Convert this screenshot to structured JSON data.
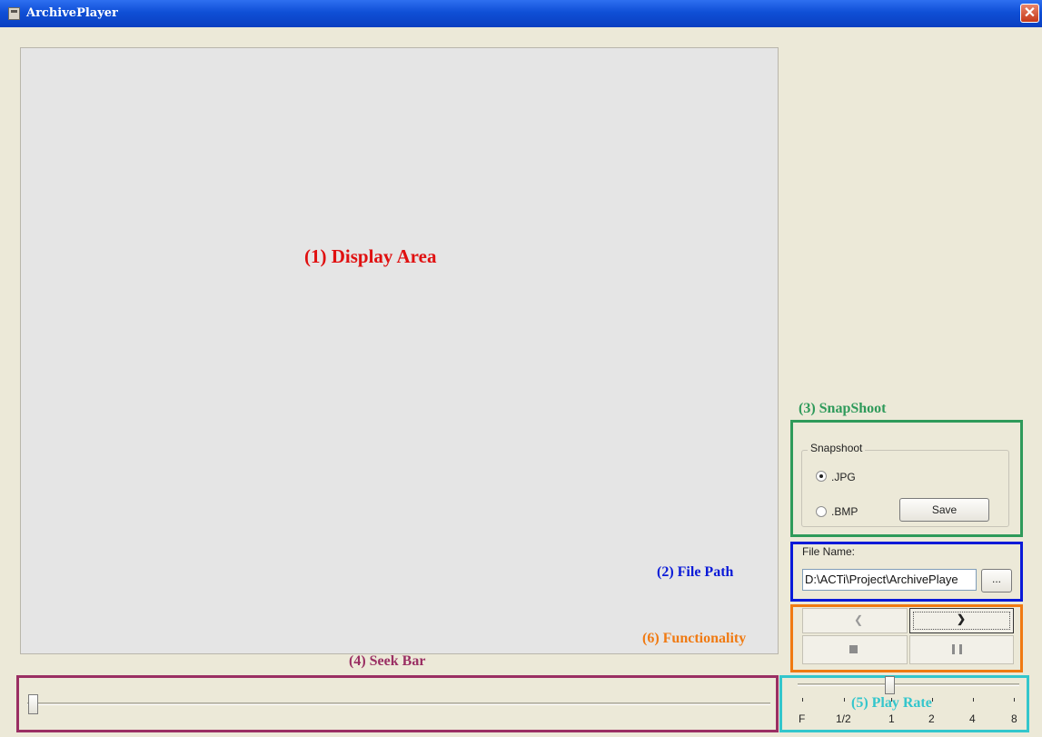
{
  "window": {
    "title": "ArchivePlayer",
    "close_glyph": "✕",
    "icon": "app-icon"
  },
  "annotations": {
    "display_area": "(1) Display Area",
    "file_path": "(2) File Path",
    "snapshoot": "(3) SnapShoot",
    "seek_bar": "(4) Seek Bar",
    "play_rate": "(5) Play Rate",
    "functionality": "(6) Functionality"
  },
  "annotation_colors": {
    "display_area": "#e01010",
    "file_path": "#0a1ad8",
    "snapshoot": "#2e9a5a",
    "seek_bar": "#9a2f63",
    "play_rate": "#33c6cc",
    "functionality": "#f07a12"
  },
  "snapshot": {
    "group_label": "Snapshoot",
    "options": [
      {
        "label": ".JPG",
        "checked": true
      },
      {
        "label": ".BMP",
        "checked": false
      }
    ],
    "save_label": "Save"
  },
  "file": {
    "label": "File Name:",
    "value": "D:\\ACTi\\Project\\ArchivePlaye",
    "browse_label": "..."
  },
  "functions": {
    "prev_glyph": "❮",
    "next_glyph": "❯",
    "buttons": [
      "previous-button",
      "next-button",
      "stop-button",
      "pause-button"
    ]
  },
  "seek": {
    "position": 0.0
  },
  "play_rate": {
    "ticks": [
      "F",
      "1/2",
      "1",
      "2",
      "4",
      "8"
    ],
    "selected": "1"
  }
}
